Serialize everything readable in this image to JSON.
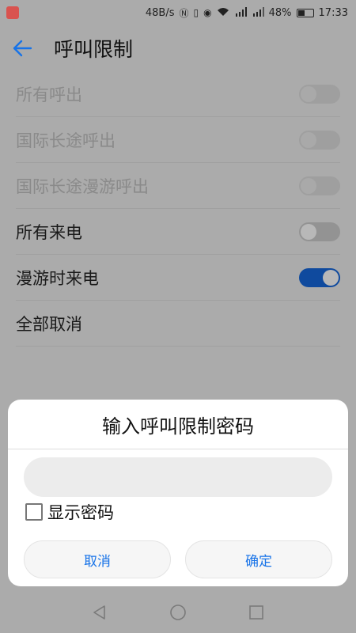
{
  "status_bar": {
    "net_speed": "48B/s",
    "battery_percent": "48%",
    "battery_level": 0.48,
    "time": "17:33",
    "icons": [
      "nfc-icon",
      "vibrate-icon",
      "eye-icon",
      "wifi-icon",
      "signal-4g-icon",
      "signal-3g-icon",
      "battery-icon"
    ]
  },
  "header": {
    "title": "呼叫限制"
  },
  "settings": [
    {
      "label": "所有呼出",
      "has_switch": true,
      "enabled": false,
      "on": false
    },
    {
      "label": "国际长途呼出",
      "has_switch": true,
      "enabled": false,
      "on": false
    },
    {
      "label": "国际长途漫游呼出",
      "has_switch": true,
      "enabled": false,
      "on": false
    },
    {
      "label": "所有来电",
      "has_switch": true,
      "enabled": true,
      "on": false
    },
    {
      "label": "漫游时来电",
      "has_switch": true,
      "enabled": true,
      "on": true
    },
    {
      "label": "全部取消",
      "has_switch": false,
      "enabled": true,
      "on": false
    }
  ],
  "dialog": {
    "title": "输入呼叫限制密码",
    "password_value": "",
    "password_placeholder": "",
    "show_password_label": "显示密码",
    "show_password_checked": false,
    "cancel_label": "取消",
    "ok_label": "确定"
  },
  "colors": {
    "accent": "#1773e8",
    "switch_on": "#0f4a9e",
    "scrim_background": "#ababab"
  }
}
